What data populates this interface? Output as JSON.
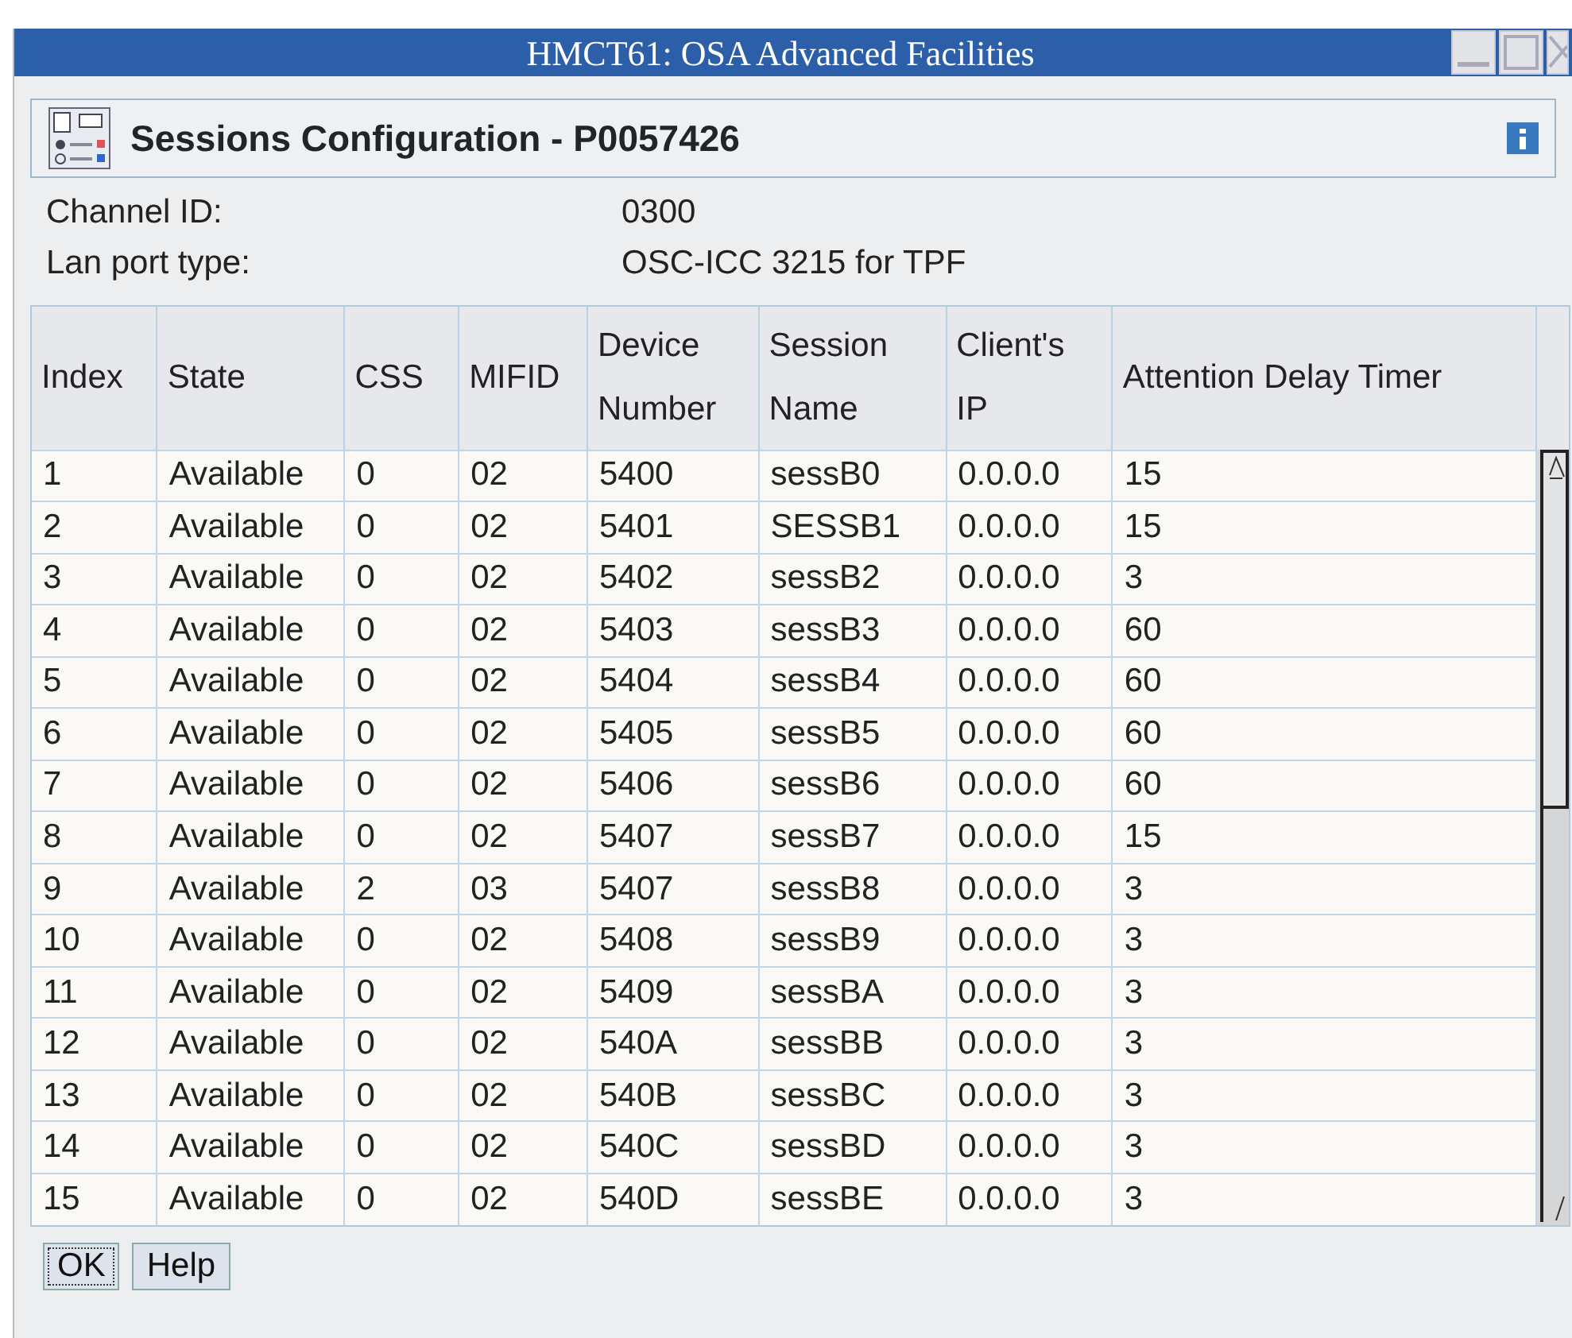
{
  "window": {
    "title": "HMCT61: OSA Advanced Facilities"
  },
  "header": {
    "title": "Sessions Configuration - P0057426"
  },
  "info": [
    {
      "label": "Channel ID:",
      "value": "0300"
    },
    {
      "label": "Lan port type:",
      "value": "OSC-ICC 3215 for TPF"
    }
  ],
  "table": {
    "columns": [
      "Index",
      "State",
      "CSS",
      "MIFID",
      "Device\nNumber",
      "Session\nName",
      "Client's\nIP",
      "Attention Delay Timer"
    ],
    "rows": [
      [
        "1",
        "Available",
        "0",
        "02",
        "5400",
        "sessB0",
        "0.0.0.0",
        "15"
      ],
      [
        "2",
        "Available",
        "0",
        "02",
        "5401",
        "SESSB1",
        "0.0.0.0",
        "15"
      ],
      [
        "3",
        "Available",
        "0",
        "02",
        "5402",
        "sessB2",
        "0.0.0.0",
        "3"
      ],
      [
        "4",
        "Available",
        "0",
        "02",
        "5403",
        "sessB3",
        "0.0.0.0",
        "60"
      ],
      [
        "5",
        "Available",
        "0",
        "02",
        "5404",
        "sessB4",
        "0.0.0.0",
        "60"
      ],
      [
        "6",
        "Available",
        "0",
        "02",
        "5405",
        "sessB5",
        "0.0.0.0",
        "60"
      ],
      [
        "7",
        "Available",
        "0",
        "02",
        "5406",
        "sessB6",
        "0.0.0.0",
        "60"
      ],
      [
        "8",
        "Available",
        "0",
        "02",
        "5407",
        "sessB7",
        "0.0.0.0",
        "15"
      ],
      [
        "9",
        "Available",
        "2",
        "03",
        "5407",
        "sessB8",
        "0.0.0.0",
        "3"
      ],
      [
        "10",
        "Available",
        "0",
        "02",
        "5408",
        "sessB9",
        "0.0.0.0",
        "3"
      ],
      [
        "11",
        "Available",
        "0",
        "02",
        "5409",
        "sessBA",
        "0.0.0.0",
        "3"
      ],
      [
        "12",
        "Available",
        "0",
        "02",
        "540A",
        "sessBB",
        "0.0.0.0",
        "3"
      ],
      [
        "13",
        "Available",
        "0",
        "02",
        "540B",
        "sessBC",
        "0.0.0.0",
        "3"
      ],
      [
        "14",
        "Available",
        "0",
        "02",
        "540C",
        "sessBD",
        "0.0.0.0",
        "3"
      ],
      [
        "15",
        "Available",
        "0",
        "02",
        "540D",
        "sessBE",
        "0.0.0.0",
        "3"
      ]
    ]
  },
  "buttons": [
    "OK",
    "Help"
  ]
}
